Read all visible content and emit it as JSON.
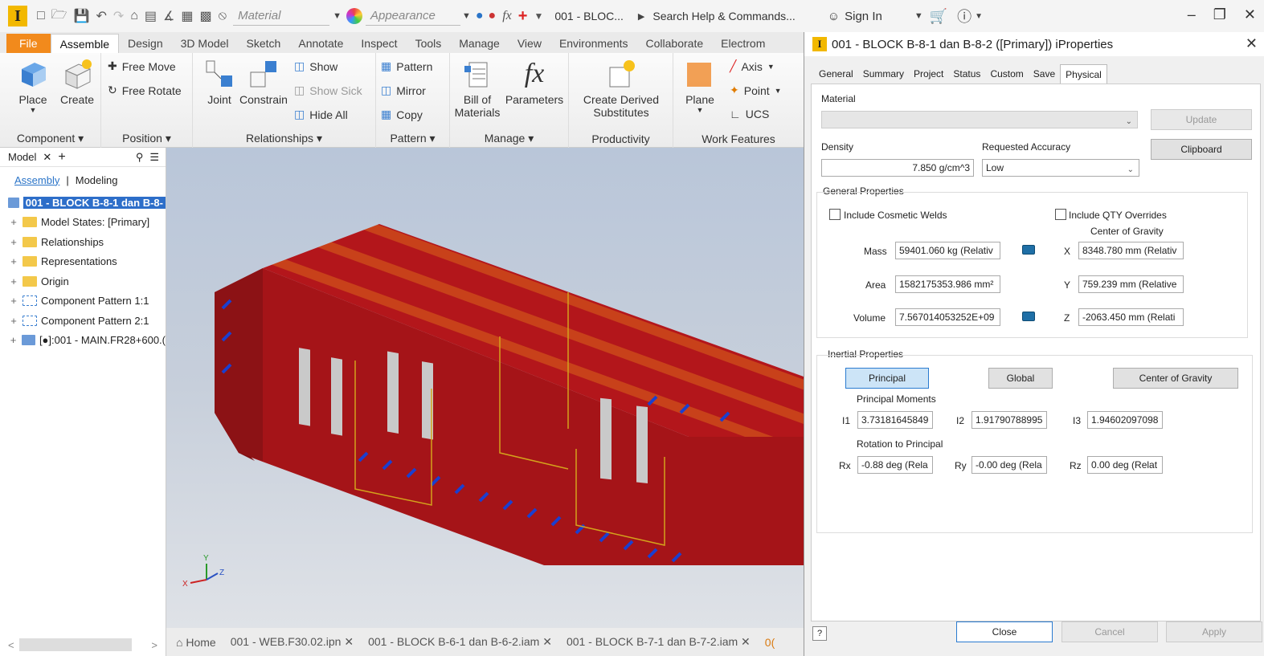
{
  "app": {
    "logo_letter": "I",
    "material_combo": "Material",
    "appearance_combo": "Appearance",
    "doc_title": "001 - BLOC...",
    "search_placeholder": "Search Help & Commands...",
    "sign_in": "Sign In",
    "accent": "#f28a1c"
  },
  "ribbon_tabs": [
    "File",
    "Assemble",
    "Design",
    "3D Model",
    "Sketch",
    "Annotate",
    "Inspect",
    "Tools",
    "Manage",
    "View",
    "Environments",
    "Collaborate",
    "Electrom"
  ],
  "ribbon": {
    "place": "Place",
    "create": "Create",
    "component_panel": "Component",
    "free_move": "Free Move",
    "free_rotate": "Free Rotate",
    "position_panel": "Position",
    "joint": "Joint",
    "constrain": "Constrain",
    "show": "Show",
    "show_sick": "Show Sick",
    "hide_all": "Hide All",
    "relationships_panel": "Relationships",
    "pattern": "Pattern",
    "mirror": "Mirror",
    "copy": "Copy",
    "pattern_panel": "Pattern",
    "bom_line1": "Bill of",
    "bom_line2": "Materials",
    "parameters": "Parameters",
    "manage_panel": "Manage",
    "create_derived_line1": "Create Derived",
    "create_derived_line2": "Substitutes",
    "productivity_panel": "Productivity",
    "plane": "Plane",
    "axis": "Axis",
    "point": "Point",
    "ucs": "UCS",
    "work_features_panel": "Work Features"
  },
  "browser": {
    "title": "Model",
    "tab_assembly": "Assembly",
    "tab_modeling": "Modeling",
    "root": "001 - BLOCK B-8-1 dan B-8-",
    "items": [
      "Model States: [Primary]",
      "Relationships",
      "Representations",
      "Origin",
      "Component Pattern 1:1",
      "Component Pattern 2:1",
      "[●]:001 - MAIN.FR28+600.("
    ]
  },
  "doc_tabs": {
    "home": "Home",
    "tabs": [
      "001 - WEB.F30.02.ipn",
      "001 - BLOCK B-6-1 dan B-6-2.iam",
      "001 - BLOCK B-7-1 dan B-7-2.iam"
    ],
    "trailing": "0("
  },
  "dialog": {
    "title": "001 - BLOCK B-8-1 dan B-8-2 ([Primary]) iProperties",
    "tabs": [
      "General",
      "Summary",
      "Project",
      "Status",
      "Custom",
      "Save",
      "Physical"
    ],
    "active_tab": "Physical",
    "material_label": "Material",
    "material_value": "",
    "update_button": "Update",
    "clipboard_button": "Clipboard",
    "density_label": "Density",
    "density_value": "7.850 g/cm^3",
    "accuracy_label": "Requested Accuracy",
    "accuracy_value": "Low",
    "general_properties": "General Properties",
    "include_cosmetic_welds": "Include Cosmetic Welds",
    "include_qty_overrides": "Include QTY Overrides",
    "center_of_gravity_label": "Center of Gravity",
    "mass_label": "Mass",
    "mass_value": "59401.060 kg (Relativ",
    "area_label": "Area",
    "area_value": "1582175353.986 mm²",
    "volume_label": "Volume",
    "volume_value": "7.567014053252E+09",
    "x_label": "X",
    "x_value": "8348.780 mm (Relativ",
    "y_label": "Y",
    "y_value": "759.239 mm (Relative",
    "z_label": "Z",
    "z_value": "-2063.450 mm (Relati",
    "inertial_properties": "Inertial Properties",
    "principal_button": "Principal",
    "global_button": "Global",
    "cog_button": "Center of Gravity",
    "principal_moments": "Principal Moments",
    "i1_label": "I1",
    "i1_value": "3.73181645849",
    "i2_label": "I2",
    "i2_value": "1.91790788995",
    "i3_label": "I3",
    "i3_value": "1.94602097098",
    "rotation_to_principal": "Rotation to Principal",
    "rx_label": "Rx",
    "rx_value": "-0.88 deg (Rela",
    "ry_label": "Ry",
    "ry_value": "-0.00 deg (Rela",
    "rz_label": "Rz",
    "rz_value": "0.00 deg (Relat",
    "close_button": "Close",
    "cancel_button": "Cancel",
    "apply_button": "Apply",
    "help_icon": "question-icon"
  },
  "colors": {
    "model_red": "#b3161b",
    "model_stripe": "#c8411a",
    "model_blue": "#1a3fd0",
    "selection_blue": "#2d6ec9"
  }
}
